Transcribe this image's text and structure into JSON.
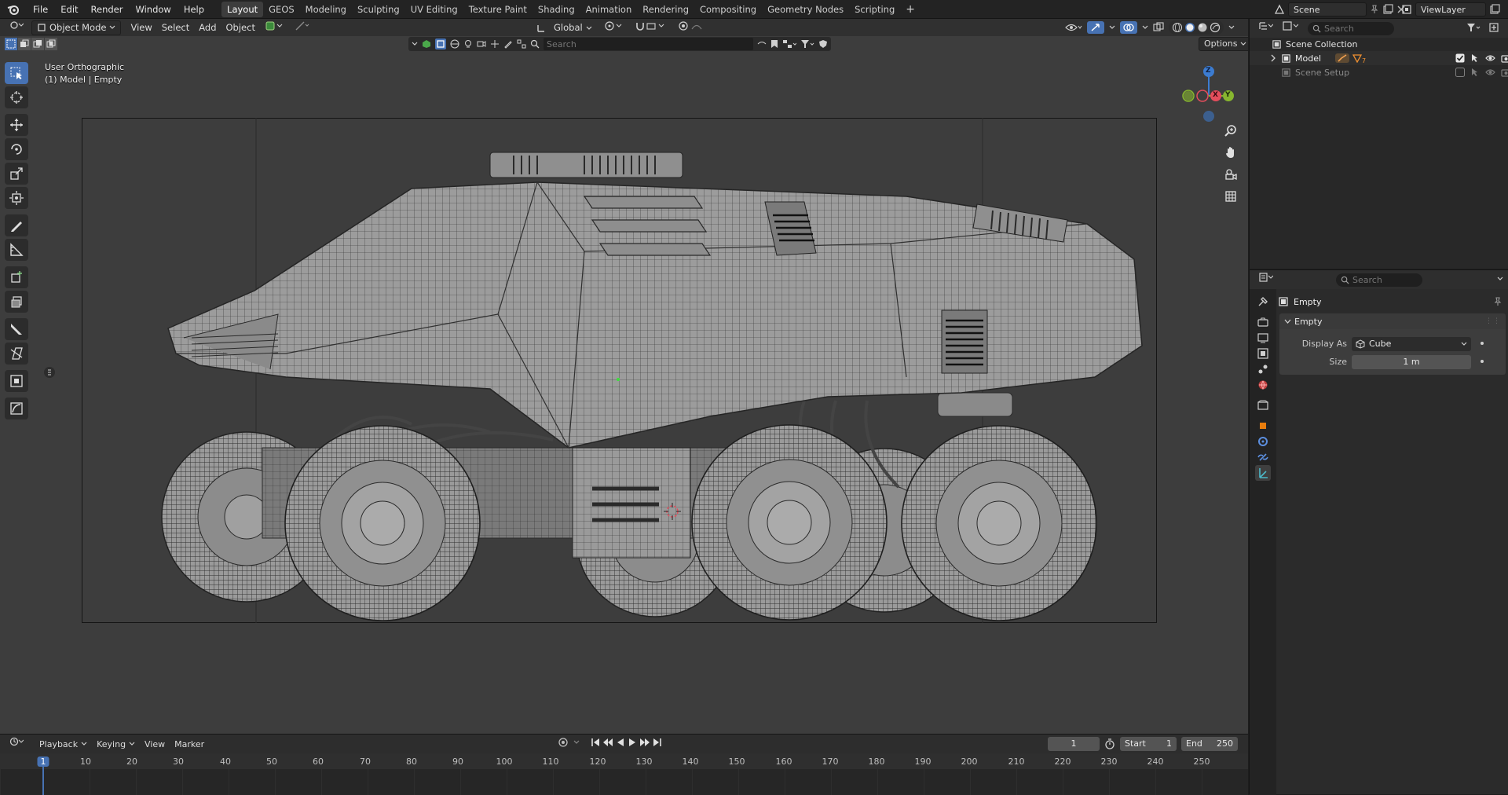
{
  "menus": [
    "File",
    "Edit",
    "Render",
    "Window",
    "Help"
  ],
  "workspaces": [
    "Layout",
    "GEOS",
    "Modeling",
    "Sculpting",
    "UV Editing",
    "Texture Paint",
    "Shading",
    "Animation",
    "Rendering",
    "Compositing",
    "Geometry Nodes",
    "Scripting"
  ],
  "active_workspace": "Layout",
  "topbar": {
    "scene": "Scene",
    "view_layer": "ViewLayer",
    "add_tab": "+"
  },
  "viewport": {
    "mode": "Object Mode",
    "menus": [
      "View",
      "Select",
      "Add",
      "Object"
    ],
    "transform_orientation": "Global",
    "search_placeholder": "Search",
    "options_label": "Options",
    "overlay_line1": "User Orthographic",
    "overlay_line2": "(1) Model | Empty",
    "gizmo": {
      "x": "X",
      "y": "Y",
      "z": "Z"
    }
  },
  "timeline": {
    "menus": [
      "Playback",
      "Keying",
      "View",
      "Marker"
    ],
    "current_frame": "1",
    "start_label": "Start",
    "start_value": "1",
    "end_label": "End",
    "end_value": "250",
    "ruler": [
      "1",
      "10",
      "20",
      "30",
      "40",
      "50",
      "60",
      "70",
      "80",
      "90",
      "100",
      "110",
      "120",
      "130",
      "140",
      "150",
      "160",
      "170",
      "180",
      "190",
      "200",
      "210",
      "220",
      "230",
      "240",
      "250"
    ]
  },
  "outliner": {
    "search_placeholder": "Search",
    "root": "Scene Collection",
    "items": [
      {
        "label": "Model",
        "badge": "7"
      },
      {
        "label": "Scene Setup"
      }
    ]
  },
  "properties": {
    "search_placeholder": "Search",
    "object_name": "Empty",
    "panel_title": "Empty",
    "display_as_label": "Display As",
    "display_as_value": "Cube",
    "size_label": "Size",
    "size_value": "1 m"
  },
  "colors": {
    "accent": "#4772b3",
    "axis_x": "#e34d5c",
    "axis_y": "#87b62f",
    "axis_z": "#3c7cd1",
    "object_data": "#e87d0d"
  }
}
